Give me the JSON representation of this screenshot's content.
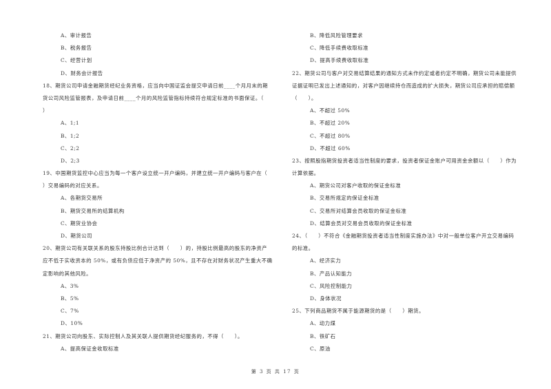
{
  "left_column": [
    {
      "type": "option",
      "text": "A、审计报告"
    },
    {
      "type": "option",
      "text": "B、税务报告"
    },
    {
      "type": "option",
      "text": "C、经营计划"
    },
    {
      "type": "option",
      "text": "D、财务会计报告"
    },
    {
      "type": "question",
      "text": "18、期货公司申请金融期货经纪业务资格，应当向中国证监会提交申请日前____个月月末的期"
    },
    {
      "type": "question",
      "text": "货公司风险监管报表，及申请日前____个月的风险监管指标持续符合规定标准的书面保证。（"
    },
    {
      "type": "question",
      "text": "）"
    },
    {
      "type": "option",
      "text": "A、1;1"
    },
    {
      "type": "option",
      "text": "B、1;2"
    },
    {
      "type": "option",
      "text": "C、2;2"
    },
    {
      "type": "option",
      "text": "D、2;3"
    },
    {
      "type": "question",
      "text": "19、中国期货监控中心应当为每一个客户设立统一开户编码，并建立统一开户编码与客户在（"
    },
    {
      "type": "question",
      "text": "）交易编码的对应关系。"
    },
    {
      "type": "option",
      "text": "A、各期货交易所"
    },
    {
      "type": "option",
      "text": "B、期货交易所的结算机构"
    },
    {
      "type": "option",
      "text": "C、期货业协会"
    },
    {
      "type": "option",
      "text": "D、期货公司"
    },
    {
      "type": "question",
      "text": "20、期货公司有关联关系的股东持股比例合计达到（　　）的，持股比例最高的股东的净资产"
    },
    {
      "type": "question",
      "text": "应不低于实收资本的 50%，或有负债应低于净资产的 50%，且不存在对财务状况产生重大不确"
    },
    {
      "type": "question",
      "text": "定影响的其他风险。"
    },
    {
      "type": "option",
      "text": "A、3%"
    },
    {
      "type": "option",
      "text": "B、5%"
    },
    {
      "type": "option",
      "text": "C、7%"
    },
    {
      "type": "option",
      "text": "D、10%"
    },
    {
      "type": "question",
      "text": "21、期货公司向股东、实际控制人及其关联人提供期货经纪服务的，不得（　　）。"
    },
    {
      "type": "option",
      "text": "A、提高保证金收取标准"
    }
  ],
  "right_column": [
    {
      "type": "option",
      "text": "B、降低风险管理要求"
    },
    {
      "type": "option",
      "text": "C、降低手续费收取标准"
    },
    {
      "type": "option",
      "text": "D、提高手续费收取标准"
    },
    {
      "type": "question",
      "text": "22、期货公司与客户对交易结算结果的通知方式未作约定或者约定不明确，期货公司未能提供"
    },
    {
      "type": "question",
      "text": "证据证明已发出上述通知的，对客户因继续持仓而造成的扩大损失，期货公司应承担的赔偿额"
    },
    {
      "type": "question",
      "text": "（　　）。"
    },
    {
      "type": "option",
      "text": "A、不超过 50%"
    },
    {
      "type": "option",
      "text": "B、不超过 20%"
    },
    {
      "type": "option",
      "text": "C、不超过 80%"
    },
    {
      "type": "option",
      "text": "D、不超过 60%"
    },
    {
      "type": "question",
      "text": "23、按照股指期货投资者适当性制度的要求，投资者保证金账户可用资金余额以（　　）作为"
    },
    {
      "type": "question",
      "text": "计算依据。"
    },
    {
      "type": "option",
      "text": "A、期货公司对客户收取的保证金标准"
    },
    {
      "type": "option",
      "text": "B、交易所规定的保证金标准"
    },
    {
      "type": "option",
      "text": "C、交易所对结算会员收取的保证金标准"
    },
    {
      "type": "option",
      "text": "D、结算会员对交易会员收取的保证金标准"
    },
    {
      "type": "question",
      "text": "24、（　　）不符合《金融期货投资者适当性制度实施办法》中对一般单位客户开立交易编码"
    },
    {
      "type": "question",
      "text": "的标准。"
    },
    {
      "type": "option",
      "text": "A、经济实力"
    },
    {
      "type": "option",
      "text": "B、产品认知能力"
    },
    {
      "type": "option",
      "text": "C、风险控制能力"
    },
    {
      "type": "option",
      "text": "D、身体状况"
    },
    {
      "type": "question",
      "text": "25、下列商品期货不属于能源期货的是（　　）期货。"
    },
    {
      "type": "option",
      "text": "A、动力煤"
    },
    {
      "type": "option",
      "text": "B、铁矿石"
    },
    {
      "type": "option",
      "text": "C、原油"
    }
  ],
  "footer": {
    "page_label": "第 3 页 共 17 页"
  }
}
